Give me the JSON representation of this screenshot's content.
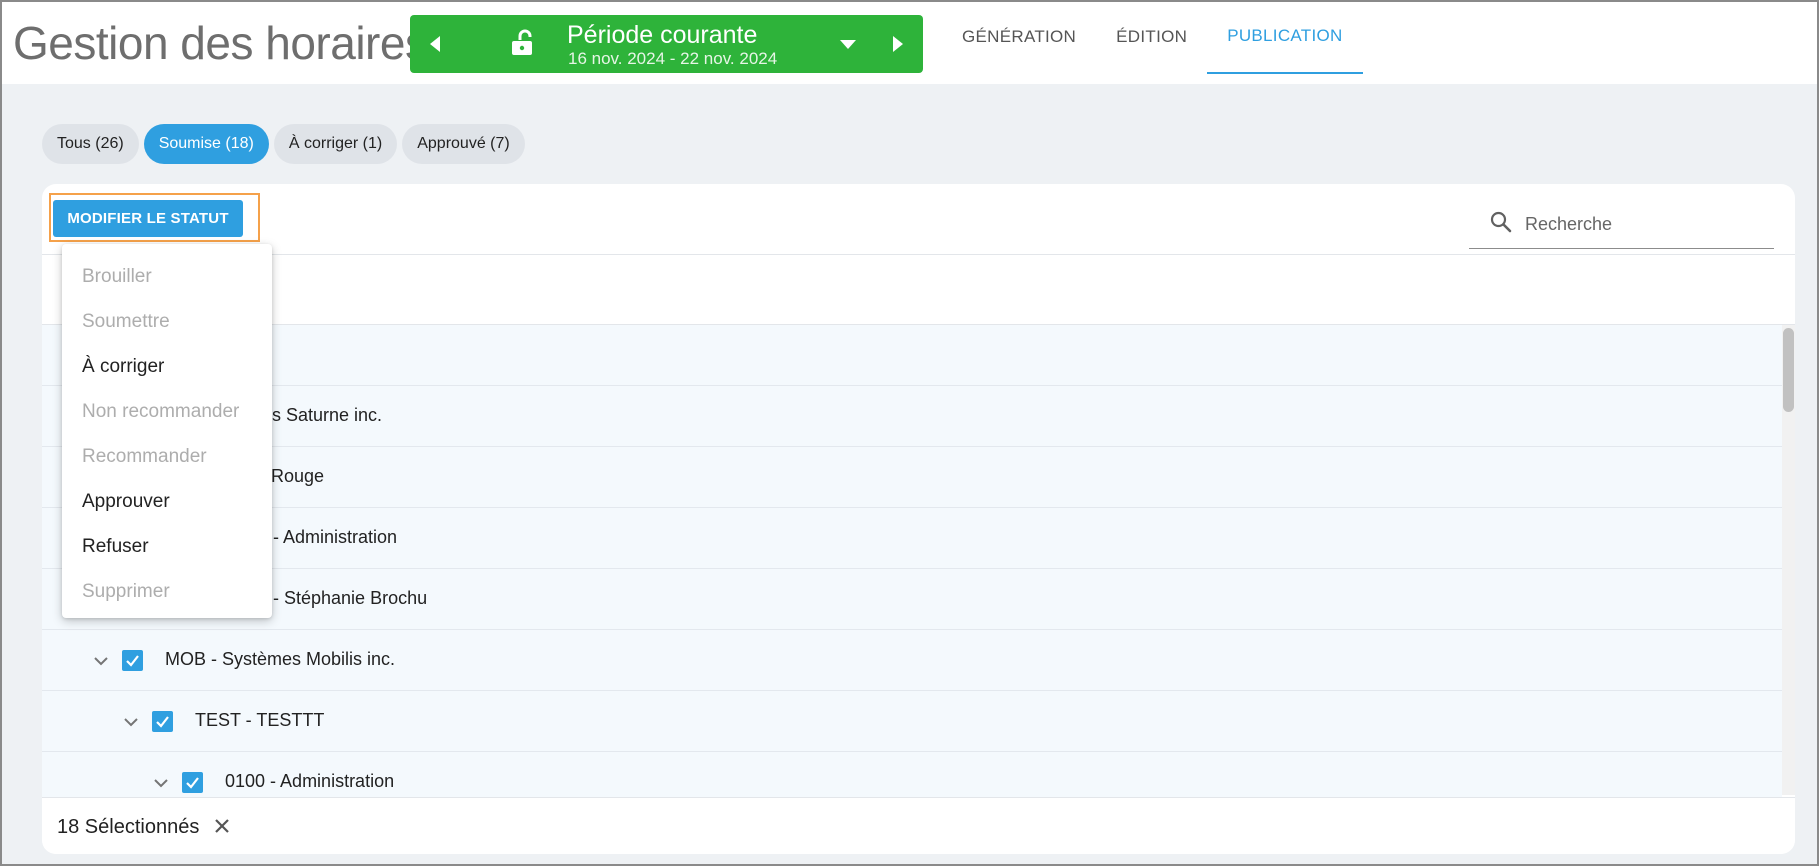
{
  "header": {
    "title": "Gestion des horaires",
    "period": {
      "title": "Période courante",
      "dates": "16 nov. 2024 - 22 nov. 2024",
      "color": "#2eb33a"
    },
    "tabs": [
      {
        "label": "GÉNÉRATION",
        "active": false
      },
      {
        "label": "ÉDITION",
        "active": false
      },
      {
        "label": "PUBLICATION",
        "active": true
      }
    ]
  },
  "filters": [
    {
      "label": "Tous (26)",
      "active": false
    },
    {
      "label": "Soumise (18)",
      "active": true
    },
    {
      "label": "À corriger (1)",
      "active": false
    },
    {
      "label": "Approuvé (7)",
      "active": false
    }
  ],
  "toolbar": {
    "status_button": "MODIFIER LE STATUT",
    "search_placeholder": "Recherche",
    "search_value": ""
  },
  "status_menu": [
    {
      "label": "Brouiller",
      "enabled": false
    },
    {
      "label": "Soumettre",
      "enabled": false
    },
    {
      "label": "À corriger",
      "enabled": true
    },
    {
      "label": "Non recommander",
      "enabled": false
    },
    {
      "label": "Recommander",
      "enabled": false
    },
    {
      "label": "Approuver",
      "enabled": true
    },
    {
      "label": "Refuser",
      "enabled": true
    },
    {
      "label": "Supprimer",
      "enabled": false
    }
  ],
  "rows": [
    {
      "label": "",
      "level": 0,
      "checked": true
    },
    {
      "label": "s Saturne inc.",
      "level": 0,
      "checked": true
    },
    {
      "label": "Rouge",
      "level": 1,
      "checked": true
    },
    {
      "label": "- Administration",
      "level": 2,
      "checked": true
    },
    {
      "label": "- Stéphanie Brochu",
      "level": 2,
      "checked": true
    },
    {
      "label": "MOB - Systèmes Mobilis inc.",
      "level": 0,
      "checked": true
    },
    {
      "label": "TEST - TESTTT",
      "level": 1,
      "checked": true
    },
    {
      "label": "0100 - Administration",
      "level": 2,
      "checked": true
    }
  ],
  "footer": {
    "selected_text": "18 Sélectionnés"
  },
  "colors": {
    "accent": "#2f9fe0",
    "highlight": "#f5a14a",
    "background": "#eef1f4"
  }
}
